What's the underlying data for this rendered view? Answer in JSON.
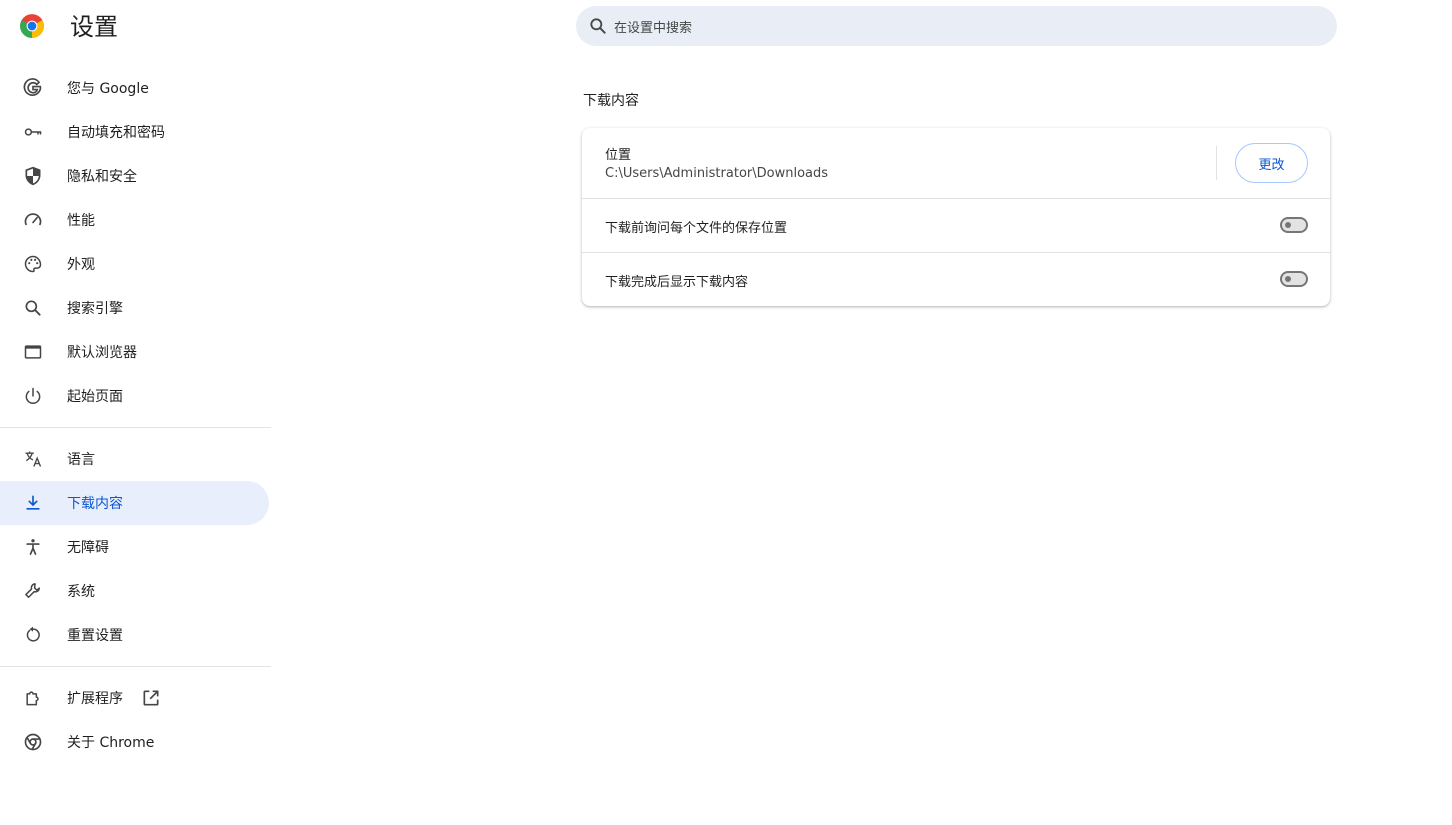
{
  "header": {
    "title": "设置",
    "search": {
      "placeholder": "在设置中搜索"
    }
  },
  "sidebar": {
    "groups": [
      [
        {
          "label": "您与 Google",
          "icon": "google-icon"
        },
        {
          "label": "自动填充和密码",
          "icon": "key-icon"
        },
        {
          "label": "隐私和安全",
          "icon": "shield-icon"
        },
        {
          "label": "性能",
          "icon": "speedometer-icon"
        },
        {
          "label": "外观",
          "icon": "palette-icon"
        },
        {
          "label": "搜索引擎",
          "icon": "search-icon"
        },
        {
          "label": "默认浏览器",
          "icon": "browser-window-icon"
        },
        {
          "label": "起始页面",
          "icon": "power-icon"
        }
      ],
      [
        {
          "label": "语言",
          "icon": "translate-icon"
        },
        {
          "label": "下载内容",
          "icon": "download-icon",
          "active": true
        },
        {
          "label": "无障碍",
          "icon": "accessibility-icon"
        },
        {
          "label": "系统",
          "icon": "wrench-icon"
        },
        {
          "label": "重置设置",
          "icon": "reset-icon"
        }
      ],
      [
        {
          "label": "扩展程序",
          "icon": "puzzle-icon",
          "external": true
        },
        {
          "label": "关于 Chrome",
          "icon": "chrome-icon"
        }
      ]
    ]
  },
  "main": {
    "section_title": "下载内容",
    "location": {
      "label": "位置",
      "path": "C:\\Users\\Administrator\\Downloads",
      "change_button": "更改"
    },
    "ask_where_to_save": {
      "label": "下载前询问每个文件的保存位置",
      "enabled": false
    },
    "show_downloads_when_done": {
      "label": "下载完成后显示下载内容",
      "enabled": false
    }
  },
  "colors": {
    "accent": "#0b57d0",
    "active_bg": "#e8eefc",
    "search_bg": "#e9eef6",
    "icon": "#444746"
  }
}
